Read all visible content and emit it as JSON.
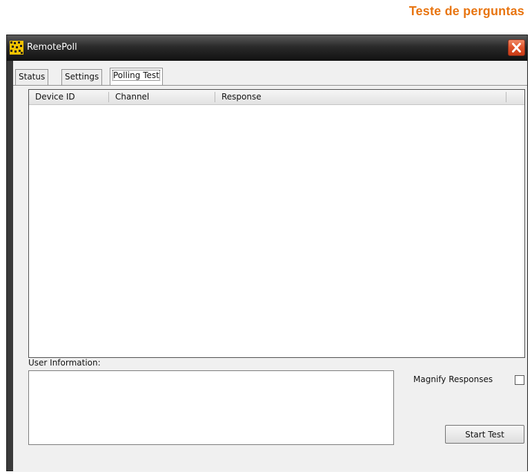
{
  "document": {
    "heading": "Teste de perguntas"
  },
  "window": {
    "title": "RemotePoll",
    "icon": "remotepoll-app-icon",
    "close_icon": "close-icon",
    "accent_close": "#e0532a"
  },
  "tabs": [
    {
      "label": "Status",
      "active": false
    },
    {
      "label": "Settings",
      "active": false
    },
    {
      "label": "Polling Test",
      "active": true
    }
  ],
  "results_table": {
    "columns": [
      "Device ID",
      "Channel",
      "Response"
    ],
    "rows": []
  },
  "user_information": {
    "label": "User Information:",
    "value": ""
  },
  "magnify_responses": {
    "label": "Magnify Responses",
    "checked": false
  },
  "start_button": {
    "label": "Start Test"
  }
}
